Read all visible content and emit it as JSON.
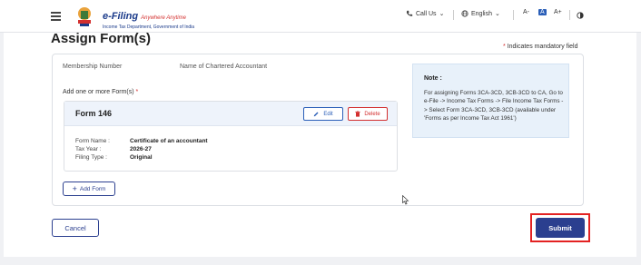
{
  "header": {
    "brand_name": "e-Filing",
    "brand_tagline": "Anywhere Anytime",
    "brand_sub": "Income Tax Department, Government of India",
    "call_us": "Call Us",
    "language": "English",
    "font_decrease": "A-",
    "font_normal": "A",
    "font_increase": "A+"
  },
  "page": {
    "title": "Assign Form(s)",
    "mandatory_note": "Indicates mandatory field",
    "mandatory_star": "*"
  },
  "fields": {
    "membership_label": "Membership Number",
    "ca_name_label": "Name of Chartered Accountant",
    "add_forms_label": "Add one or more Form(s)",
    "add_forms_star": "*"
  },
  "form_card": {
    "title": "Form 146",
    "edit_label": "Edit",
    "delete_label": "Delete",
    "rows": [
      {
        "key": "Form Name :",
        "value": "Certificate of an accountant"
      },
      {
        "key": "Tax Year :",
        "value": "2026-27"
      },
      {
        "key": "Filing Type :",
        "value": "Original"
      }
    ]
  },
  "add_form_label": "Add Form",
  "note": {
    "title": "Note :",
    "body": "For assigning Forms 3CA-3CD, 3CB-3CD to CA, Go to e-File -> Income Tax Forms -> File Income Tax Forms -> Select Form 3CA-3CD, 3CB-3CD (available under 'Forms as per Income Tax Act 1961')"
  },
  "actions": {
    "cancel_label": "Cancel",
    "submit_label": "Submit"
  },
  "colors": {
    "primary": "#2b3f8f",
    "highlight": "#e32222",
    "delete": "#d32f2f",
    "note_bg": "#e8f1fa"
  }
}
